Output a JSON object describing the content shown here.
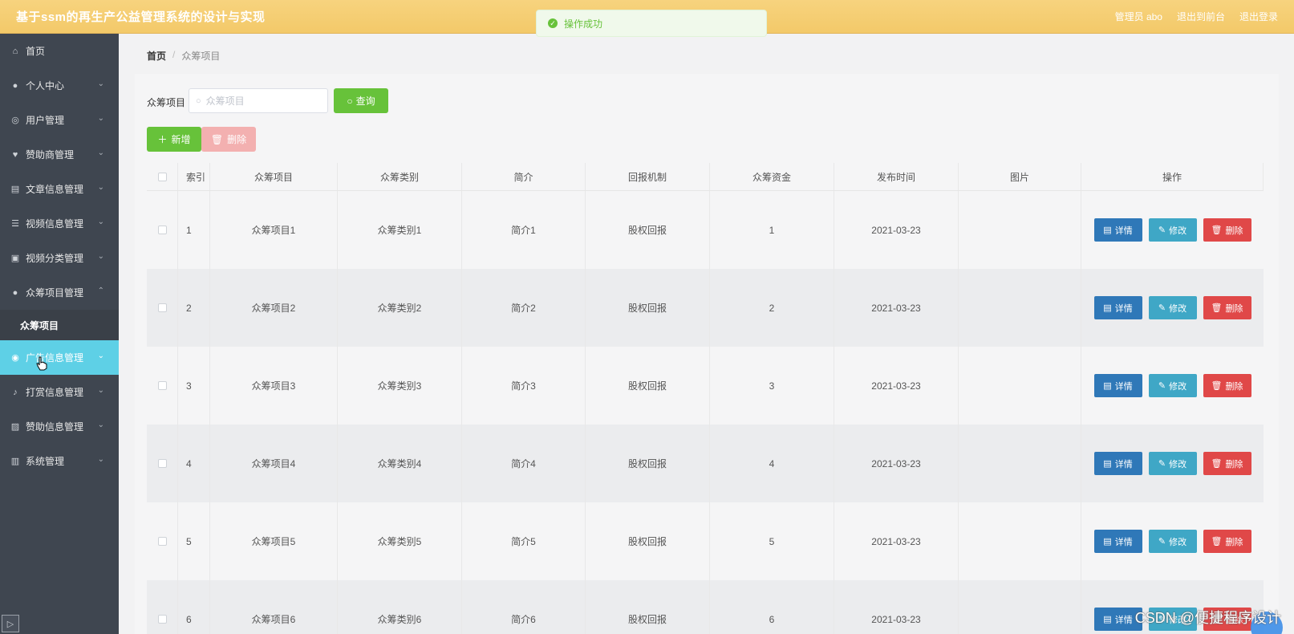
{
  "header": {
    "title": "基于ssm的再生产公益管理系统的设计与实现",
    "user": "管理员 abo",
    "back_front": "退出到前台",
    "logout": "退出登录"
  },
  "toast": {
    "message": "操作成功"
  },
  "sidebar": {
    "items": [
      {
        "label": "首页",
        "icon": "home-icon"
      },
      {
        "label": "个人中心",
        "icon": "user-icon"
      },
      {
        "label": "用户管理",
        "icon": "users-icon"
      },
      {
        "label": "赞助商管理",
        "icon": "sponsor-icon"
      },
      {
        "label": "文章信息管理",
        "icon": "article-icon"
      },
      {
        "label": "视频信息管理",
        "icon": "video-icon"
      },
      {
        "label": "视频分类管理",
        "icon": "category-icon"
      },
      {
        "label": "众筹项目管理",
        "icon": "crowdfund-icon"
      },
      {
        "label": "众筹项目",
        "icon": ""
      },
      {
        "label": "广告信息管理",
        "icon": "ad-icon"
      },
      {
        "label": "打赏信息管理",
        "icon": "reward-icon"
      },
      {
        "label": "赞助信息管理",
        "icon": "sponsorship-icon"
      },
      {
        "label": "系统管理",
        "icon": "system-icon"
      }
    ]
  },
  "breadcrumb": {
    "home": "首页",
    "sep": "/",
    "current": "众筹项目"
  },
  "search": {
    "label": "众筹项目",
    "placeholder": "众筹项目",
    "button": "查询"
  },
  "actions": {
    "add": "新增",
    "delete": "删除"
  },
  "table": {
    "headers": [
      "索引",
      "众筹项目",
      "众筹类别",
      "简介",
      "回报机制",
      "众筹资金",
      "发布时间",
      "图片",
      "操作"
    ],
    "rows": [
      {
        "idx": "1",
        "name": "众筹项目1",
        "type": "众筹类别1",
        "intro": "简介1",
        "ret": "股权回报",
        "fund": "1",
        "date": "2021-03-23"
      },
      {
        "idx": "2",
        "name": "众筹项目2",
        "type": "众筹类别2",
        "intro": "简介2",
        "ret": "股权回报",
        "fund": "2",
        "date": "2021-03-23"
      },
      {
        "idx": "3",
        "name": "众筹项目3",
        "type": "众筹类别3",
        "intro": "简介3",
        "ret": "股权回报",
        "fund": "3",
        "date": "2021-03-23"
      },
      {
        "idx": "4",
        "name": "众筹项目4",
        "type": "众筹类别4",
        "intro": "简介4",
        "ret": "股权回报",
        "fund": "4",
        "date": "2021-03-23"
      },
      {
        "idx": "5",
        "name": "众筹项目5",
        "type": "众筹类别5",
        "intro": "简介5",
        "ret": "股权回报",
        "fund": "5",
        "date": "2021-03-23"
      },
      {
        "idx": "6",
        "name": "众筹项目6",
        "type": "众筹类别6",
        "intro": "简介6",
        "ret": "股权回报",
        "fund": "6",
        "date": "2021-03-23"
      }
    ],
    "op_labels": {
      "detail": "详情",
      "edit": "修改",
      "remove": "删除"
    }
  },
  "watermark": "CSDN @便捷程序设计",
  "colors": {
    "header": "#f3c969",
    "sidebar": "#3f4650",
    "active": "#5ed0e6",
    "success": "#67c23a",
    "danger": "#e04848",
    "primary": "#2f78b8",
    "info": "#3fa7c6"
  }
}
